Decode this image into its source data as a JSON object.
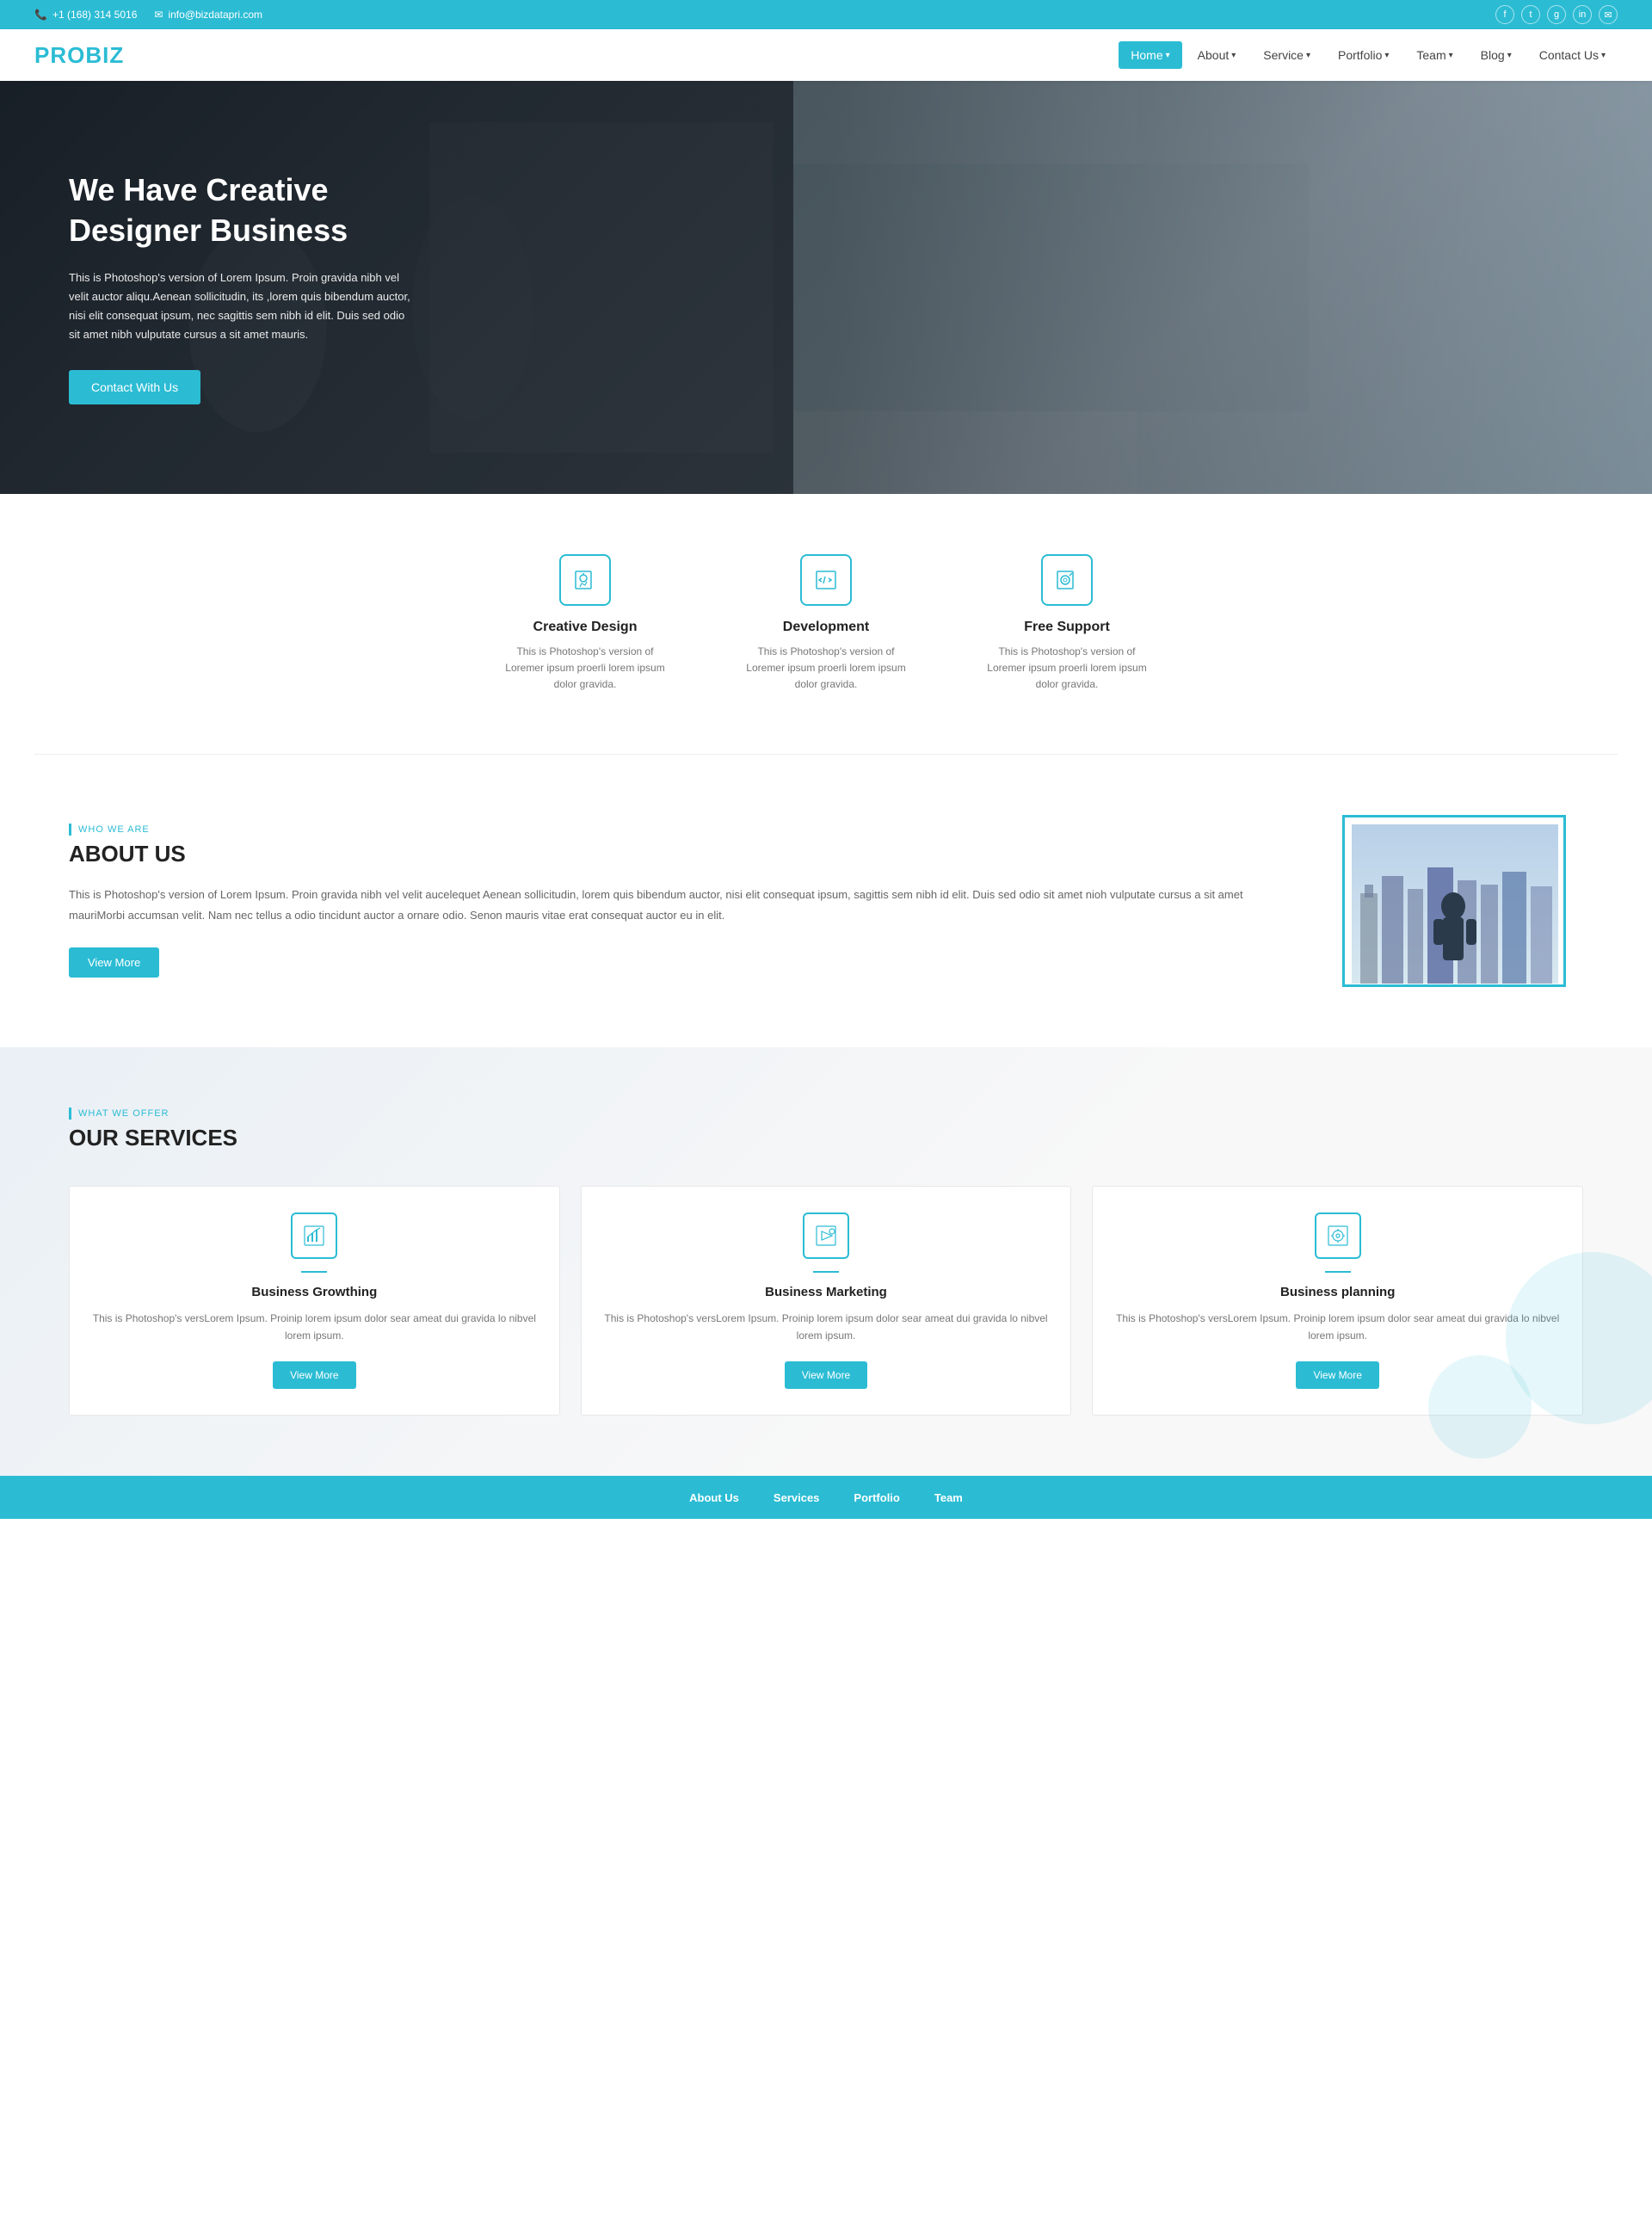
{
  "topbar": {
    "phone": "+1 (168) 314 5016",
    "email": "info@bizdatapri.com",
    "phone_icon": "📞",
    "email_icon": "✉",
    "social": [
      "f",
      "t",
      "g+",
      "in",
      "✉"
    ]
  },
  "navbar": {
    "logo": "PROBIZ",
    "items": [
      {
        "label": "Home",
        "active": true,
        "has_arrow": true
      },
      {
        "label": "About",
        "active": false,
        "has_arrow": true
      },
      {
        "label": "Service",
        "active": false,
        "has_arrow": true
      },
      {
        "label": "Portfolio",
        "active": false,
        "has_arrow": true
      },
      {
        "label": "Team",
        "active": false,
        "has_arrow": true
      },
      {
        "label": "Blog",
        "active": false,
        "has_arrow": true
      },
      {
        "label": "Contact Us",
        "active": false,
        "has_arrow": true
      }
    ]
  },
  "hero": {
    "title": "We Have Creative Designer Business",
    "description": "This is Photoshop's version of Lorem Ipsum. Proin gravida nibh vel velit auctor aliqu.Aenean sollicitudin, its ,lorem quis bibendum auctor, nisi elit consequat ipsum, nec sagittis sem nibh id elit. Duis sed odio sit amet nibh vulputate cursus a sit amet mauris.",
    "cta_button": "Contact With Us"
  },
  "features": {
    "items": [
      {
        "title": "Creative Design",
        "description": "This is Photoshop's version of Loremer ipsum proerli lorem ipsum dolor gravida.",
        "icon": "💡"
      },
      {
        "title": "Development",
        "description": "This is Photoshop's version of Loremer ipsum proerli lorem ipsum dolor gravida.",
        "icon": "</>"
      },
      {
        "title": "Free Support",
        "description": "This is Photoshop's version of Loremer ipsum proerli lorem ipsum dolor gravida.",
        "icon": "⊕"
      }
    ]
  },
  "about": {
    "label": "WHO WE ARE",
    "title": "ABOUT US",
    "description": "This is Photoshop's version of Lorem Ipsum. Proin gravida nibh vel velit aucelequet Aenean sollicitudin, lorem quis bibendum auctor, nisi elit consequat ipsum, sagittis sem nibh id elit. Duis sed odio sit amet nioh vulputate cursus a sit amet mauriMorbi accumsan velit. Nam nec tellus a odio tincidunt auctor a ornare odio. Senon mauris vitae erat consequat auctor eu in elit.",
    "button": "View More"
  },
  "services": {
    "label": "WHAT WE OFFER",
    "title": "OUR SERVICES",
    "cards": [
      {
        "title": "Business Growthing",
        "description": "This is Photoshop's versLorem Ipsum. Proinip lorem ipsum dolor sear ameat dui gravida lo nibvel lorem ipsum.",
        "icon": "📊",
        "button": "View More"
      },
      {
        "title": "Business Marketing",
        "description": "This is Photoshop's versLorem Ipsum. Proinip lorem ipsum dolor sear ameat dui gravida lo nibvel lorem ipsum.",
        "icon": "📣",
        "button": "View More"
      },
      {
        "title": "Business planning",
        "description": "This is Photoshop's versLorem Ipsum. Proinip lorem ipsum dolor sear ameat dui gravida lo nibvel lorem ipsum.",
        "icon": "⚙",
        "button": "View More"
      }
    ]
  },
  "footer_preview": {
    "items": [
      "About Us",
      "Services",
      "Portfolio",
      "Team"
    ]
  },
  "colors": {
    "primary": "#2bbcd4",
    "dark": "#222222",
    "text_muted": "#777777"
  }
}
